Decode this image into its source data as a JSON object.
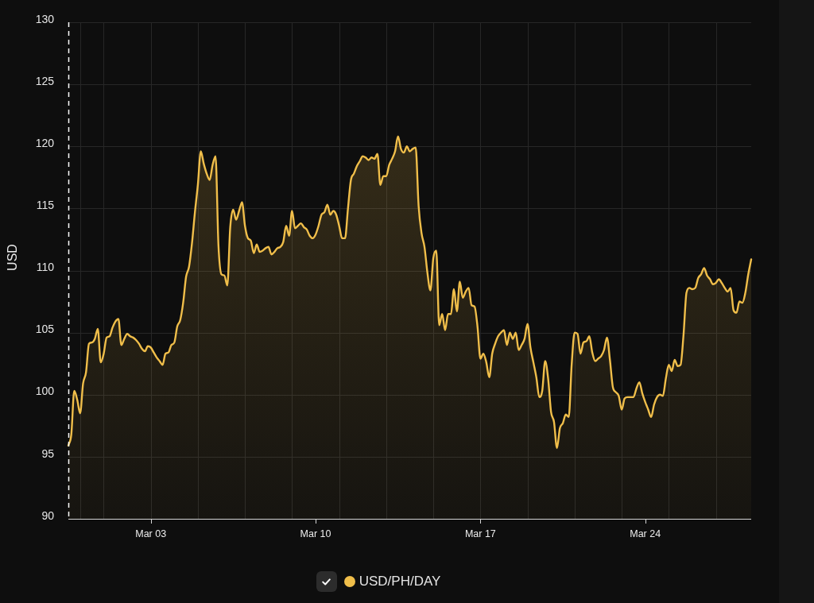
{
  "chart": {
    "chart_data": {
      "type": "area",
      "ylabel": "USD",
      "ylim": [
        90,
        130
      ],
      "yticks": [
        90,
        95,
        100,
        105,
        110,
        115,
        120,
        125,
        130
      ],
      "grid": true,
      "categories": [
        null,
        null,
        null,
        null,
        null,
        null,
        null,
        null,
        null,
        null,
        null,
        null,
        null,
        null,
        null,
        null,
        null,
        null,
        null,
        null,
        null,
        null,
        null,
        null,
        null,
        null,
        null,
        null,
        "Mar 03",
        null,
        null,
        null,
        null,
        null,
        null,
        null,
        null,
        null,
        null,
        null,
        null,
        null,
        null,
        null,
        null,
        null,
        null,
        null,
        null,
        null,
        null,
        null,
        null,
        null,
        null,
        null,
        null,
        null,
        null,
        null,
        null,
        null,
        null,
        null,
        null,
        null,
        null,
        null,
        null,
        null,
        null,
        null,
        null,
        null,
        null,
        null,
        null,
        null,
        null,
        null,
        null,
        null,
        null,
        null,
        "Mar 10",
        null,
        null,
        null,
        null,
        null,
        null,
        null,
        null,
        null,
        null,
        null,
        null,
        null,
        null,
        null,
        null,
        null,
        null,
        null,
        null,
        null,
        null,
        null,
        null,
        null,
        null,
        null,
        null,
        null,
        null,
        null,
        null,
        null,
        null,
        null,
        null,
        null,
        null,
        null,
        null,
        null,
        null,
        null,
        null,
        null,
        null,
        null,
        null,
        null,
        null,
        null,
        null,
        null,
        null,
        null,
        "Mar 17",
        null,
        null,
        null,
        null,
        null,
        null,
        null,
        null,
        null,
        null,
        null,
        null,
        null,
        null,
        null,
        null,
        null,
        null,
        null,
        null,
        null,
        null,
        null,
        null,
        null,
        null,
        null,
        null,
        null,
        null,
        null,
        null,
        null,
        null,
        null,
        null,
        null,
        null,
        null,
        null,
        null,
        null,
        null,
        null,
        null,
        null,
        null,
        null,
        null,
        null,
        null,
        null,
        null,
        null,
        null,
        "Mar 24",
        null,
        null,
        null,
        null,
        null,
        null,
        null,
        null,
        null,
        null,
        null,
        null,
        null,
        null,
        null,
        null,
        null,
        null,
        null,
        null,
        null,
        null,
        null,
        null,
        null,
        null,
        null,
        null,
        null,
        null,
        null,
        null,
        null,
        null,
        null,
        null
      ],
      "series": [
        {
          "name": "USD/PH/DAY",
          "color": "#f0be4a",
          "values": [
            95.9,
            96.8,
            100.3,
            99.6,
            98.5,
            100.9,
            101.8,
            104.1,
            104.2,
            104.5,
            105.3,
            102.6,
            103.3,
            104.6,
            104.7,
            105.4,
            105.9,
            106.1,
            104.0,
            104.5,
            104.9,
            104.7,
            104.6,
            104.4,
            104.1,
            103.7,
            103.5,
            103.9,
            103.8,
            103.4,
            103.0,
            102.7,
            102.4,
            103.3,
            103.4,
            104.0,
            104.2,
            105.5,
            106.0,
            107.4,
            109.5,
            110.3,
            112.2,
            114.7,
            116.9,
            119.6,
            118.6,
            117.8,
            117.3,
            118.5,
            119.2,
            112.0,
            109.7,
            109.6,
            108.8,
            113.5,
            114.9,
            114.1,
            114.8,
            115.5,
            113.6,
            112.6,
            112.4,
            111.4,
            112.1,
            111.5,
            111.6,
            111.8,
            111.9,
            111.3,
            111.5,
            111.8,
            111.9,
            112.3,
            113.6,
            112.8,
            114.8,
            113.4,
            113.6,
            113.8,
            113.5,
            113.3,
            112.8,
            112.6,
            112.9,
            113.6,
            114.5,
            114.7,
            115.3,
            114.5,
            114.8,
            114.5,
            113.6,
            112.6,
            112.6,
            115.0,
            117.3,
            117.8,
            118.4,
            118.8,
            119.2,
            119.1,
            118.9,
            119.1,
            119.0,
            119.4,
            116.9,
            117.6,
            117.6,
            118.5,
            119.0,
            119.6,
            120.8,
            119.8,
            119.5,
            120.0,
            119.6,
            119.8,
            119.9,
            115.2,
            113.0,
            111.9,
            109.8,
            108.4,
            111.0,
            111.6,
            105.6,
            106.5,
            105.2,
            106.5,
            106.5,
            108.5,
            106.7,
            109.1,
            107.8,
            108.3,
            108.6,
            107.2,
            107.1,
            105.5,
            102.9,
            103.3,
            102.6,
            101.4,
            103.3,
            104.1,
            104.7,
            105.0,
            105.2,
            104.0,
            105.0,
            104.5,
            105.0,
            103.6,
            104.0,
            104.5,
            105.7,
            103.8,
            102.6,
            101.4,
            99.8,
            100.3,
            102.7,
            101.3,
            98.6,
            97.8,
            95.7,
            97.3,
            97.7,
            98.4,
            98.2,
            102.4,
            105.0,
            104.9,
            103.3,
            104.2,
            104.3,
            104.7,
            103.4,
            102.7,
            102.9,
            103.1,
            103.6,
            104.6,
            102.8,
            100.6,
            100.2,
            99.9,
            98.8,
            99.7,
            99.8,
            99.8,
            99.8,
            100.5,
            101.0,
            100.1,
            99.4,
            98.8,
            98.2,
            99.2,
            99.8,
            100.0,
            99.9,
            101.3,
            102.4,
            101.9,
            102.8,
            102.3,
            102.4,
            104.8,
            108.2,
            108.6,
            108.5,
            108.6,
            109.4,
            109.7,
            110.2,
            109.6,
            109.3,
            108.9,
            109.0,
            109.3,
            109.0,
            108.6,
            108.3,
            108.6,
            106.8,
            106.6,
            107.5,
            107.4,
            108.2,
            109.7,
            110.9
          ]
        }
      ]
    },
    "legend": [
      {
        "checked": true
      }
    ]
  }
}
